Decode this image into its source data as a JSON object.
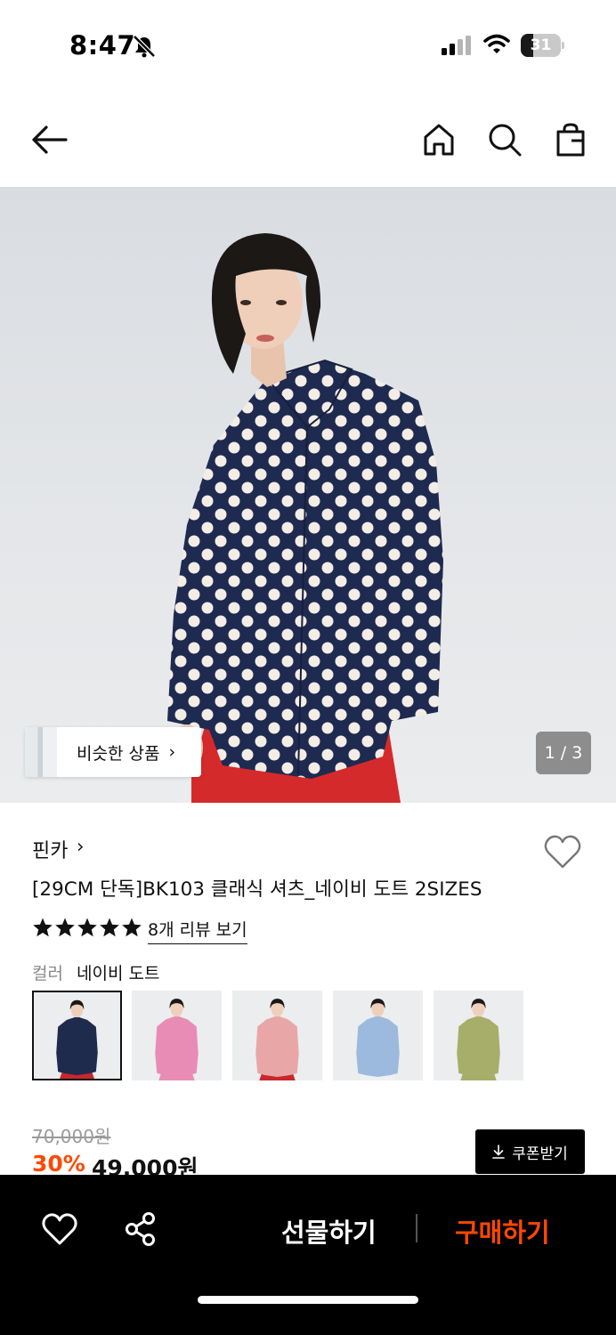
{
  "status_bar": {
    "time": "8:47",
    "battery": "31"
  },
  "hero": {
    "similar_label": "비슷한 상품",
    "similar_chevron": "›",
    "image_counter": "1 / 3"
  },
  "product": {
    "brand": "핀카",
    "brand_chevron": "›",
    "title": "[29CM 단독]BK103 클래식 셔츠_네이비 도트 2SIZES",
    "rating_stars": 5,
    "reviews_link": "8개 리뷰 보기",
    "color_label": "컬러",
    "color_value": "네이비 도트",
    "colors": [
      {
        "name": "navy-dot",
        "shirt": "#1f2b4d",
        "pants": "#c8282c",
        "selected": true
      },
      {
        "name": "pink-stripe",
        "shirt": "#e98cb5",
        "pants": "#e98cb5",
        "selected": false
      },
      {
        "name": "red-stripe",
        "shirt": "#e8a7a6",
        "pants": "#c8282c",
        "selected": false
      },
      {
        "name": "blue-stripe",
        "shirt": "#9cb9de",
        "pants": "#eef0f4",
        "selected": false
      },
      {
        "name": "green-stripe",
        "shirt": "#a7ae6a",
        "pants": "#a7ae6a",
        "selected": false
      }
    ],
    "original_price": "70,000원",
    "discount": "30%",
    "sale_price": "49,000원",
    "coupon_label": "쿠폰받기"
  },
  "bottom_bar": {
    "gift_label": "선물하기",
    "buy_label": "구매하기"
  },
  "colors": {
    "accent": "#ff4800",
    "bar_bg": "#000000"
  },
  "icons": [
    "bell-slash-icon",
    "signal-icon",
    "wifi-icon",
    "battery-icon",
    "back-arrow-icon",
    "home-icon",
    "search-icon",
    "bag-icon",
    "heart-icon",
    "star-icon",
    "download-icon",
    "share-icon"
  ]
}
